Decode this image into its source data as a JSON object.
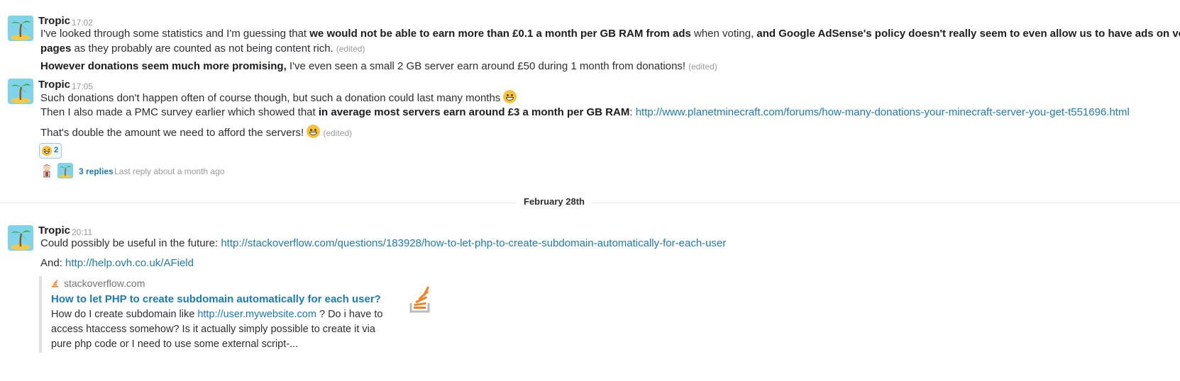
{
  "messages": [
    {
      "author": "Tropic",
      "time": "17:02",
      "lines": {
        "l1_a": "I've looked through some statistics and I'm guessing that ",
        "l1_b": "we would not be able to earn more than £0.1 a month per GB RAM from ads",
        "l1_c": " when voting, ",
        "l1_d": "and Google AdSense's policy doesn't really seem to even allow us to have ads on voting",
        "l2_a": "pages",
        "l2_b": " as they probably are counted as not being content rich.",
        "l3_a": "However donations seem much more promising,",
        "l3_b": " I've even seen a small 2 GB server earn around £50 during 1 month from donations!"
      },
      "edited": "(edited)"
    },
    {
      "author": "Tropic",
      "time": "17:05",
      "lines": {
        "l1_a": "Such donations don't happen often of course though, but such a donation could last many months",
        "l2_a": "Then I also made a PMC survey earlier which showed that ",
        "l2_b": "in average most servers earn around £3 a month per GB RAM",
        "l2_c": ": ",
        "l2_link": "http://www.planetminecraft.com/forums/how-many-donations-your-minecraft-server-you-get-t551696.html",
        "l3_a": "That's double the amount we need to afford the servers!"
      },
      "edited": "(edited)",
      "reaction": {
        "icon": "grinning-emoji",
        "count": "2"
      },
      "thread": {
        "replies": "3 replies",
        "last_reply": "Last reply about a month ago"
      }
    },
    {
      "author": "Tropic",
      "time": "20:11",
      "lines": {
        "l1_a": "Could possibly be useful in the future: ",
        "l1_link": "http://stackoverflow.com/questions/183928/how-to-let-php-to-create-subdomain-automatically-for-each-user",
        "l2_a": "And: ",
        "l2_link": "http://help.ovh.co.uk/AField"
      },
      "attachment": {
        "site": "stackoverflow.com",
        "title": "How to let PHP to create subdomain automatically for each user?",
        "body_a": "How do I create subdomain like ",
        "body_link": "http://user.mywebsite.com",
        "body_b": " ? Do i have to access htaccess somehow? Is it actually simply possible to create it via pure php code or I need to use some external script-..."
      }
    }
  ],
  "divider": {
    "label": "February 28th"
  },
  "colors": {
    "link": "#1d7ab5",
    "muted": "#9a9a9a",
    "avatar_bg": "#7fd4ea"
  }
}
